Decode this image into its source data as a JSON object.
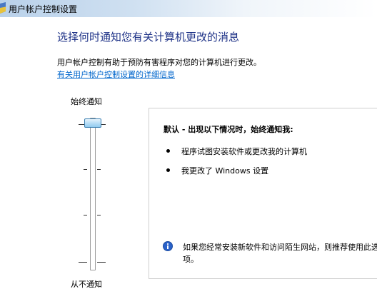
{
  "window": {
    "title": "用户帐户控制设置"
  },
  "main": {
    "heading": "选择何时通知您有关计算机更改的消息",
    "description": "用户帐户控制有助于预防有害程序对您的计算机进行更改。",
    "link": "有关用户帐户控制设置的详细信息"
  },
  "slider": {
    "top_label": "始终通知",
    "bottom_label": "从不通知",
    "levels": 4,
    "selected_level": 4
  },
  "panel": {
    "title": "默认 - 出现以下情况时，始终通知我:",
    "bullets": [
      "程序试图安装软件或更改我的计算机",
      "我更改了 Windows 设置"
    ],
    "info": "如果您经常安装新软件和访问陌生网站，则推荐使用此选项。"
  },
  "colors": {
    "heading": "#1e3287",
    "link": "#0066cc",
    "thumb": "#93cbef"
  },
  "icons": {
    "title": "uac-shield-icon",
    "info": "info-icon"
  }
}
